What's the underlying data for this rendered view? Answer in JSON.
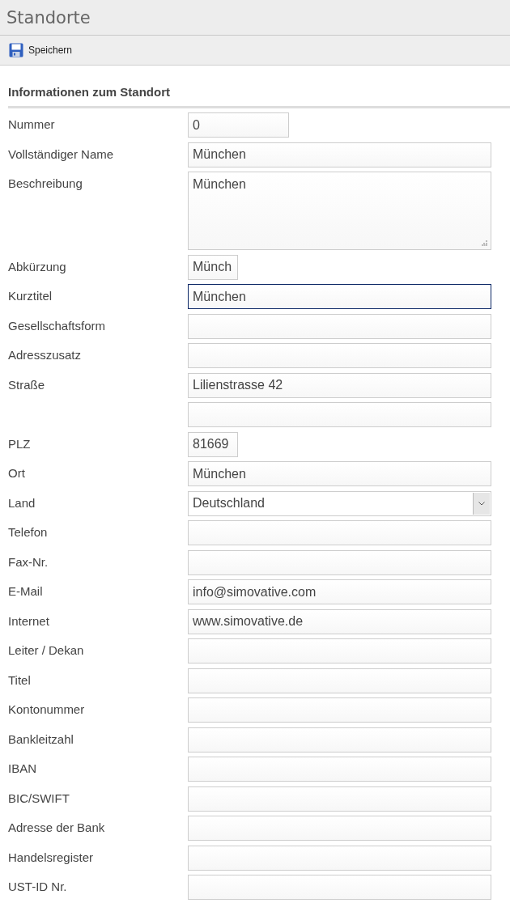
{
  "page": {
    "title": "Standorte"
  },
  "toolbar": {
    "buttons": [
      {
        "label": "Speichern",
        "kind": "save"
      }
    ]
  },
  "section": {
    "title": "Informationen zum Standort"
  },
  "fields": [
    {
      "label": "Nummer",
      "kind": "medium",
      "value": "0",
      "focused": false
    },
    {
      "label": "Vollständiger Name",
      "kind": "text",
      "value": "München",
      "focused": false
    },
    {
      "label": "Beschreibung",
      "kind": "textarea",
      "value": "München",
      "focused": false
    },
    {
      "label": "Abkürzung",
      "kind": "short",
      "value": "Münch",
      "focused": false
    },
    {
      "label": "Kurztitel",
      "kind": "text",
      "value": "München",
      "focused": true
    },
    {
      "label": "Gesellschaftsform",
      "kind": "text",
      "focused": false
    },
    {
      "label": "Adresszusatz",
      "kind": "text",
      "focused": false
    },
    {
      "label": "Straße",
      "kind": "text",
      "value": "Lilienstrasse 42",
      "focused": false
    },
    {
      "kind": "text",
      "focused": false
    },
    {
      "label": "PLZ",
      "kind": "short",
      "value": "81669",
      "focused": false
    },
    {
      "label": "Ort",
      "kind": "text",
      "value": "München",
      "focused": false
    },
    {
      "label": "Land",
      "kind": "select",
      "value": "Deutschland",
      "focused": false
    },
    {
      "label": "Telefon",
      "kind": "text",
      "focused": false
    },
    {
      "label": "Fax-Nr.",
      "kind": "text",
      "focused": false
    },
    {
      "label": "E-Mail",
      "kind": "text",
      "value": "info@simovative.com",
      "focused": false
    },
    {
      "label": "Internet",
      "kind": "text",
      "value": "www.simovative.de",
      "focused": false
    },
    {
      "label": "Leiter / Dekan",
      "kind": "text",
      "focused": false
    },
    {
      "label": "Titel",
      "kind": "text",
      "focused": false
    },
    {
      "label": "Kontonummer",
      "kind": "text",
      "focused": false
    },
    {
      "label": "Bankleitzahl",
      "kind": "text",
      "focused": false
    },
    {
      "label": "IBAN",
      "kind": "text",
      "focused": false
    },
    {
      "label": "BIC/SWIFT",
      "kind": "text",
      "focused": false
    },
    {
      "label": "Adresse der Bank",
      "kind": "text",
      "focused": false
    },
    {
      "label": "Handelsregister",
      "kind": "text",
      "focused": false
    },
    {
      "label": "UST-ID Nr.",
      "kind": "text",
      "focused": false
    }
  ]
}
